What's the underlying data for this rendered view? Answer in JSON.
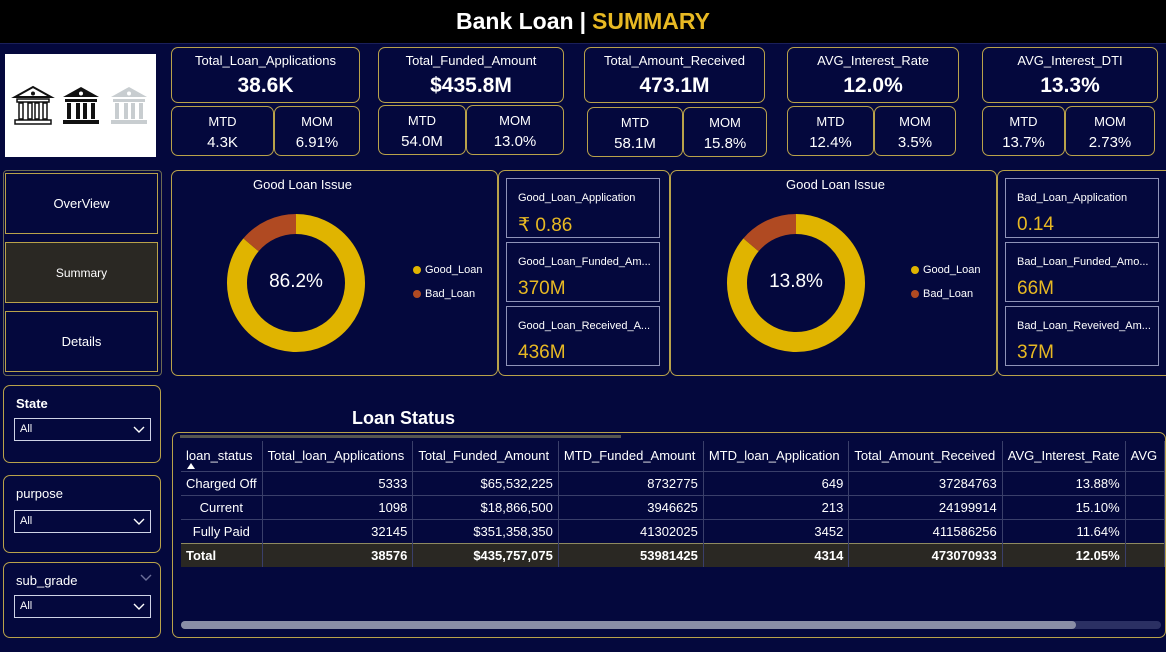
{
  "title": {
    "main": "Bank Loan",
    "separator": "|",
    "sub": "SUMMARY"
  },
  "kpis": [
    {
      "label": "Total_Loan_Applications",
      "value": "38.6K",
      "mtd_label": "MTD",
      "mtd": "4.3K",
      "mom_label": "MOM",
      "mom": "6.91%"
    },
    {
      "label": "Total_Funded_Amount",
      "value": "$435.8M",
      "mtd_label": "MTD",
      "mtd": "54.0M",
      "mom_label": "MOM",
      "mom": "13.0%"
    },
    {
      "label": "Total_Amount_Received",
      "value": "473.1M",
      "mtd_label": "MTD",
      "mtd": "58.1M",
      "mom_label": "MOM",
      "mom": "15.8%"
    },
    {
      "label": "AVG_Interest_Rate",
      "value": "12.0%",
      "mtd_label": "MTD",
      "mtd": "12.4%",
      "mom_label": "MOM",
      "mom": "3.5%"
    },
    {
      "label": "AVG_Interest_DTI",
      "value": "13.3%",
      "mtd_label": "MTD",
      "mtd": "13.7%",
      "mom_label": "MOM",
      "mom": "2.73%"
    }
  ],
  "nav": {
    "overview": "OverView",
    "summary": "Summary",
    "details": "Details"
  },
  "slicers": [
    {
      "title": "State",
      "value": "All"
    },
    {
      "title": "purpose",
      "value": "All"
    },
    {
      "title": "sub_grade",
      "value": "All"
    }
  ],
  "donuts": [
    {
      "title": "Good Loan Issue",
      "center": "86.2%",
      "good_fraction": 0.862,
      "legend_good": "Good_Loan",
      "legend_bad": "Bad_Loan"
    },
    {
      "title": "Good Loan Issue",
      "center": "13.8%",
      "good_fraction": 0.862,
      "legend_good": "Good_Loan",
      "legend_bad": "Bad_Loan"
    }
  ],
  "colors": {
    "good": "#e0b400",
    "bad": "#b04a22",
    "accent": "#e8b923"
  },
  "good_stats": [
    {
      "label": "Good_Loan_Application",
      "value": "₹ 0.86"
    },
    {
      "label": "Good_Loan_Funded_Am...",
      "value": "370M"
    },
    {
      "label": "Good_Loan_Received_A...",
      "value": "436M"
    }
  ],
  "bad_stats": [
    {
      "label": "Bad_Loan_Application",
      "value": "0.14"
    },
    {
      "label": "Bad_Loan_Funded_Amo...",
      "value": "66M"
    },
    {
      "label": "Bad_Loan_Reveived_Am...",
      "value": "37M"
    }
  ],
  "loan_status": {
    "title": "Loan Status",
    "columns": [
      "loan_status",
      "Total_loan_Applications",
      "Total_Funded_Amount",
      "MTD_Funded_Amount",
      "MTD_loan_Application",
      "Total_Amount_Received",
      "AVG_Interest_Rate",
      "AVG"
    ],
    "rows": [
      [
        "Charged Off",
        "5333",
        "$65,532,225",
        "8732775",
        "649",
        "37284763",
        "13.88%",
        ""
      ],
      [
        "Current",
        "1098",
        "$18,866,500",
        "3946625",
        "213",
        "24199914",
        "15.10%",
        ""
      ],
      [
        "Fully Paid",
        "32145",
        "$351,358,350",
        "41302025",
        "3452",
        "411586256",
        "11.64%",
        ""
      ]
    ],
    "total": [
      "Total",
      "38576",
      "$435,757,075",
      "53981425",
      "4314",
      "473070933",
      "12.05%",
      ""
    ]
  }
}
